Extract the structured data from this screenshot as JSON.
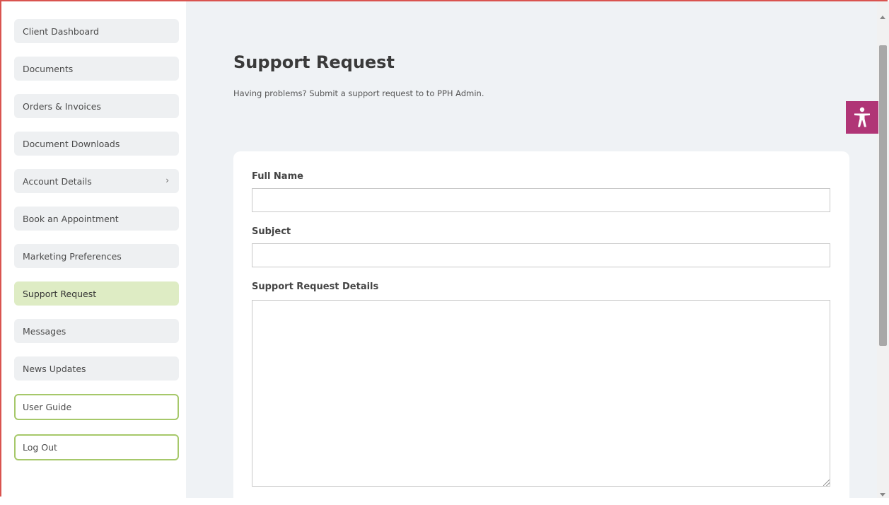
{
  "sidebar": {
    "items": [
      {
        "label": "Client Dashboard"
      },
      {
        "label": "Documents"
      },
      {
        "label": "Orders & Invoices"
      },
      {
        "label": "Document Downloads"
      },
      {
        "label": "Account Details",
        "has_submenu": true
      },
      {
        "label": "Book an Appointment"
      },
      {
        "label": "Marketing Preferences"
      },
      {
        "label": "Support Request",
        "active": true
      },
      {
        "label": "Messages"
      },
      {
        "label": "News Updates"
      }
    ],
    "user_guide": "User Guide",
    "log_out": "Log Out",
    "chevron": "›"
  },
  "main": {
    "title": "Support Request",
    "subtitle": "Having problems? Submit a support request to to PPH Admin.",
    "form": {
      "full_name_label": "Full Name",
      "full_name_value": "",
      "subject_label": "Subject",
      "subject_value": "",
      "details_label": "Support Request Details",
      "details_value": ""
    }
  },
  "accessibility": {
    "icon": "accessibility-icon"
  },
  "colors": {
    "active_nav": "#deecc4",
    "outline_nav": "#a6c86a",
    "accessibility_bg": "#b03576",
    "main_bg": "#eff2f5",
    "frame": "#d9534f"
  }
}
